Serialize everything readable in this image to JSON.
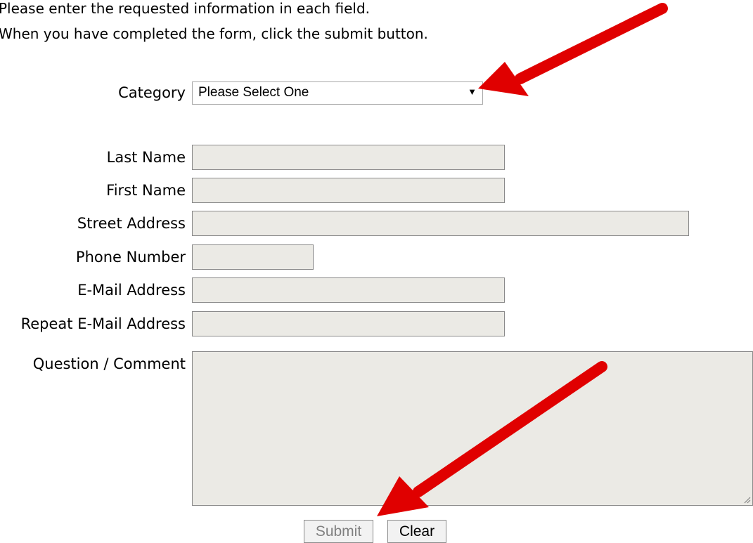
{
  "intro": {
    "line1": "Please enter the requested information in each field.",
    "line2": "When you have completed the form, click the submit button."
  },
  "category": {
    "label": "Category",
    "selected": "Please Select One",
    "arrow": "▼"
  },
  "fields": {
    "last_name": "Last Name",
    "first_name": "First Name",
    "street_address": "Street Address",
    "phone_number": "Phone Number",
    "email": "E-Mail Address",
    "repeat_email": "Repeat E-Mail Address",
    "question_comment": "Question / Comment"
  },
  "buttons": {
    "submit": "Submit",
    "clear": "Clear"
  },
  "annotation": {
    "arrow_color": "#e00000"
  }
}
